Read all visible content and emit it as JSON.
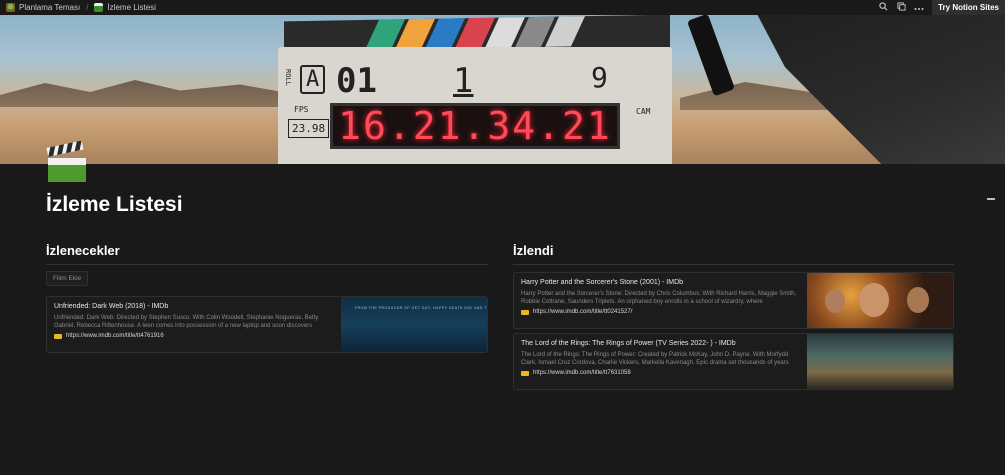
{
  "topbar": {
    "breadcrumbs": [
      {
        "label": "Planlama Teması",
        "icon": "plant-icon"
      },
      {
        "label": "İzleme Listesi",
        "icon": "clapperboard-icon"
      }
    ],
    "separator": "/",
    "try_button": "Try Notion Sites",
    "icons": [
      "search-icon",
      "duplicate-icon",
      "more-icon"
    ]
  },
  "cover": {
    "board": {
      "roll": "A",
      "scene": "01",
      "take_num": "1",
      "take": "9",
      "fps_label": "FPS",
      "fps_value": "23.98",
      "cam": "CAM",
      "timecode": "16.21.34.21",
      "stripe_colors": [
        "#2fa37a",
        "#f0a23c",
        "#2b7bc4",
        "#d9434e",
        "#dcdcdc",
        "#8a8a8a",
        "#cfcfcf"
      ]
    }
  },
  "page": {
    "title": "İzleme Listesi",
    "icon": "clapperboard-icon"
  },
  "columns": {
    "left": {
      "heading": "İzlenecekler",
      "add_button": "Filim Ekle",
      "cards": [
        {
          "title": "Unfriended: Dark Web (2018) - IMDb",
          "description": "Unfriended: Dark Web: Directed by Stephen Susco. With Colin Woodell, Stephanie Nogueras, Betty Gabriel, Rebecca Rittenhouse. A teen comes into possession of a new laptop and soon discovers",
          "url": "https://www.imdb.com/title/tt4761916",
          "thumb_text": "FROM THE PRODUCER OF GET OUT, HAPPY DEATH DAY AND THE PURGE"
        }
      ]
    },
    "right": {
      "heading": "İzlendi",
      "cards": [
        {
          "title": "Harry Potter and the Sorcerer's Stone (2001) - IMDb",
          "description": "Harry Potter and the Sorcerer's Stone: Directed by Chris Columbus. With Richard Harris, Maggie Smith, Robbie Coltrane, Saunders Triplets. An orphaned boy enrolls in a school of wizardry, where",
          "url": "https://www.imdb.com/title/tt0241527/"
        },
        {
          "title": "The Lord of the Rings: The Rings of Power (TV Series 2022- ) - IMDb",
          "description": "The Lord of the Rings: The Rings of Power: Created by Patrick McKay, John D. Payne. With Morfydd Clark, Ismael Cruz Cordova, Charlie Vickers, Markella Kavenagh. Epic drama set thousands of years",
          "url": "https://www.imdb.com/title/tt7631058"
        }
      ]
    }
  }
}
